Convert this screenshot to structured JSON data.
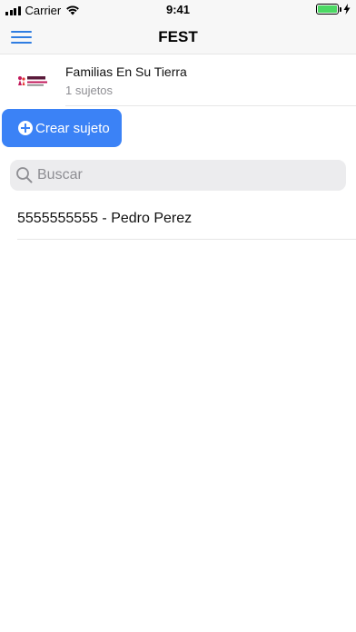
{
  "status_bar": {
    "carrier": "Carrier",
    "time": "9:41",
    "battery_level": 1.0,
    "battery_color": "#4cd964",
    "charging": true
  },
  "nav": {
    "title": "FEST",
    "menu_icon": "hamburger-menu-icon",
    "accent_color": "#2f7de1"
  },
  "organization": {
    "logo": "familias-en-su-tierra-logo",
    "logo_text": "Familias En Su Tierra",
    "name": "Familias En Su Tierra",
    "subject_count": "1 sujetos"
  },
  "create_button": {
    "label": "Crear sujeto",
    "icon": "plus-circle-icon",
    "color": "#3b82f6"
  },
  "search": {
    "placeholder": "Buscar",
    "value": ""
  },
  "subjects": [
    {
      "label": "5555555555 - Pedro Perez"
    }
  ]
}
